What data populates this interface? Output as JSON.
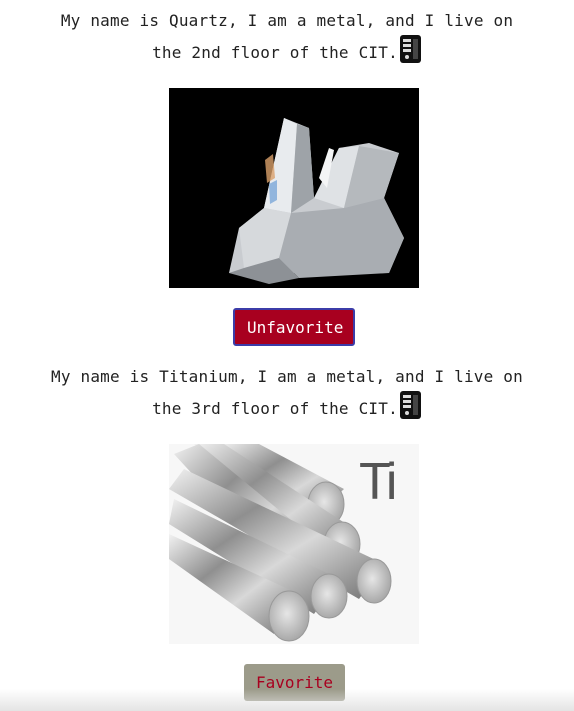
{
  "items": [
    {
      "line1": "My name is Quartz, I am a metal, and I live on",
      "line2": "the 2nd floor of the CIT.",
      "icon": "computer-icon",
      "image_alt": "Quartz crystal cluster",
      "button_label": "Unfavorite"
    },
    {
      "line1": "My name is Titanium, I am a metal, and I live on",
      "line2": "the 3rd floor of the CIT.",
      "icon": "computer-icon",
      "image_alt": "Titanium rods",
      "image_label": "Ti",
      "button_label": "Favorite"
    }
  ],
  "colors": {
    "unfavorite_bg": "#a8001f",
    "favorite_bg": "#9c9b8a",
    "favorite_text": "#a8001f"
  }
}
